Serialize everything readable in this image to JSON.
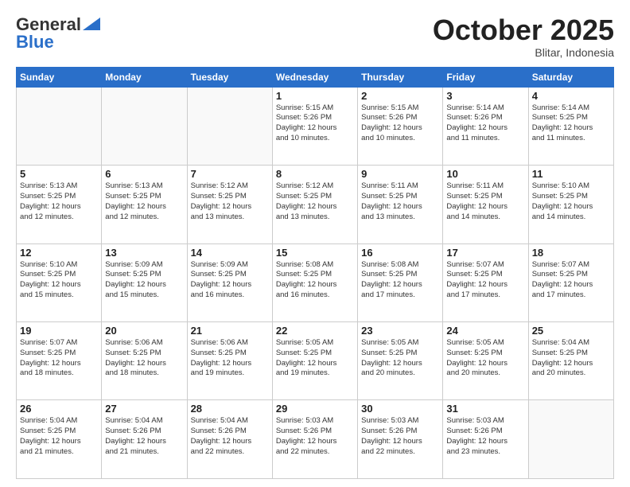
{
  "header": {
    "logo_line1": "General",
    "logo_line2": "Blue",
    "month": "October 2025",
    "location": "Blitar, Indonesia"
  },
  "weekdays": [
    "Sunday",
    "Monday",
    "Tuesday",
    "Wednesday",
    "Thursday",
    "Friday",
    "Saturday"
  ],
  "weeks": [
    [
      {
        "day": "",
        "info": ""
      },
      {
        "day": "",
        "info": ""
      },
      {
        "day": "",
        "info": ""
      },
      {
        "day": "1",
        "info": "Sunrise: 5:15 AM\nSunset: 5:26 PM\nDaylight: 12 hours\nand 10 minutes."
      },
      {
        "day": "2",
        "info": "Sunrise: 5:15 AM\nSunset: 5:26 PM\nDaylight: 12 hours\nand 10 minutes."
      },
      {
        "day": "3",
        "info": "Sunrise: 5:14 AM\nSunset: 5:26 PM\nDaylight: 12 hours\nand 11 minutes."
      },
      {
        "day": "4",
        "info": "Sunrise: 5:14 AM\nSunset: 5:25 PM\nDaylight: 12 hours\nand 11 minutes."
      }
    ],
    [
      {
        "day": "5",
        "info": "Sunrise: 5:13 AM\nSunset: 5:25 PM\nDaylight: 12 hours\nand 12 minutes."
      },
      {
        "day": "6",
        "info": "Sunrise: 5:13 AM\nSunset: 5:25 PM\nDaylight: 12 hours\nand 12 minutes."
      },
      {
        "day": "7",
        "info": "Sunrise: 5:12 AM\nSunset: 5:25 PM\nDaylight: 12 hours\nand 13 minutes."
      },
      {
        "day": "8",
        "info": "Sunrise: 5:12 AM\nSunset: 5:25 PM\nDaylight: 12 hours\nand 13 minutes."
      },
      {
        "day": "9",
        "info": "Sunrise: 5:11 AM\nSunset: 5:25 PM\nDaylight: 12 hours\nand 13 minutes."
      },
      {
        "day": "10",
        "info": "Sunrise: 5:11 AM\nSunset: 5:25 PM\nDaylight: 12 hours\nand 14 minutes."
      },
      {
        "day": "11",
        "info": "Sunrise: 5:10 AM\nSunset: 5:25 PM\nDaylight: 12 hours\nand 14 minutes."
      }
    ],
    [
      {
        "day": "12",
        "info": "Sunrise: 5:10 AM\nSunset: 5:25 PM\nDaylight: 12 hours\nand 15 minutes."
      },
      {
        "day": "13",
        "info": "Sunrise: 5:09 AM\nSunset: 5:25 PM\nDaylight: 12 hours\nand 15 minutes."
      },
      {
        "day": "14",
        "info": "Sunrise: 5:09 AM\nSunset: 5:25 PM\nDaylight: 12 hours\nand 16 minutes."
      },
      {
        "day": "15",
        "info": "Sunrise: 5:08 AM\nSunset: 5:25 PM\nDaylight: 12 hours\nand 16 minutes."
      },
      {
        "day": "16",
        "info": "Sunrise: 5:08 AM\nSunset: 5:25 PM\nDaylight: 12 hours\nand 17 minutes."
      },
      {
        "day": "17",
        "info": "Sunrise: 5:07 AM\nSunset: 5:25 PM\nDaylight: 12 hours\nand 17 minutes."
      },
      {
        "day": "18",
        "info": "Sunrise: 5:07 AM\nSunset: 5:25 PM\nDaylight: 12 hours\nand 17 minutes."
      }
    ],
    [
      {
        "day": "19",
        "info": "Sunrise: 5:07 AM\nSunset: 5:25 PM\nDaylight: 12 hours\nand 18 minutes."
      },
      {
        "day": "20",
        "info": "Sunrise: 5:06 AM\nSunset: 5:25 PM\nDaylight: 12 hours\nand 18 minutes."
      },
      {
        "day": "21",
        "info": "Sunrise: 5:06 AM\nSunset: 5:25 PM\nDaylight: 12 hours\nand 19 minutes."
      },
      {
        "day": "22",
        "info": "Sunrise: 5:05 AM\nSunset: 5:25 PM\nDaylight: 12 hours\nand 19 minutes."
      },
      {
        "day": "23",
        "info": "Sunrise: 5:05 AM\nSunset: 5:25 PM\nDaylight: 12 hours\nand 20 minutes."
      },
      {
        "day": "24",
        "info": "Sunrise: 5:05 AM\nSunset: 5:25 PM\nDaylight: 12 hours\nand 20 minutes."
      },
      {
        "day": "25",
        "info": "Sunrise: 5:04 AM\nSunset: 5:25 PM\nDaylight: 12 hours\nand 20 minutes."
      }
    ],
    [
      {
        "day": "26",
        "info": "Sunrise: 5:04 AM\nSunset: 5:25 PM\nDaylight: 12 hours\nand 21 minutes."
      },
      {
        "day": "27",
        "info": "Sunrise: 5:04 AM\nSunset: 5:26 PM\nDaylight: 12 hours\nand 21 minutes."
      },
      {
        "day": "28",
        "info": "Sunrise: 5:04 AM\nSunset: 5:26 PM\nDaylight: 12 hours\nand 22 minutes."
      },
      {
        "day": "29",
        "info": "Sunrise: 5:03 AM\nSunset: 5:26 PM\nDaylight: 12 hours\nand 22 minutes."
      },
      {
        "day": "30",
        "info": "Sunrise: 5:03 AM\nSunset: 5:26 PM\nDaylight: 12 hours\nand 22 minutes."
      },
      {
        "day": "31",
        "info": "Sunrise: 5:03 AM\nSunset: 5:26 PM\nDaylight: 12 hours\nand 23 minutes."
      },
      {
        "day": "",
        "info": ""
      }
    ]
  ]
}
